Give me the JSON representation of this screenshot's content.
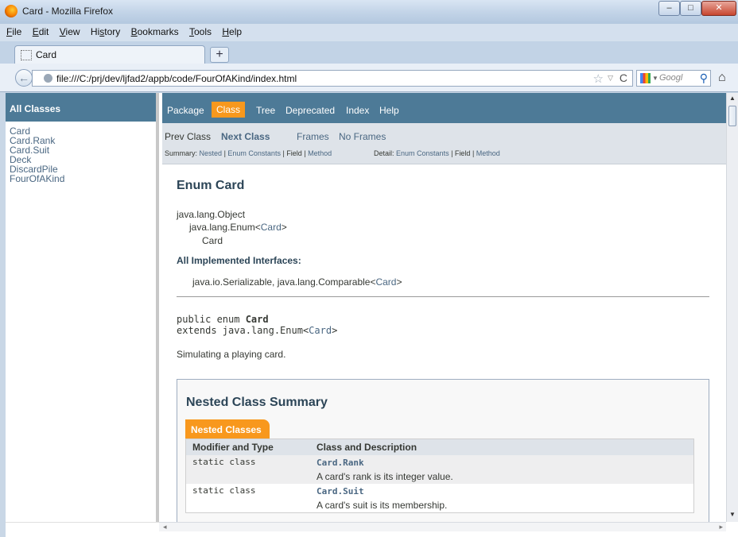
{
  "window": {
    "title": "Card - Mozilla Firefox",
    "min_label": "–",
    "max_label": "□",
    "close_label": "✕"
  },
  "menu": [
    {
      "label_u": "F",
      "label_rest": "ile"
    },
    {
      "label_u": "E",
      "label_rest": "dit"
    },
    {
      "label_u": "V",
      "label_rest": "iew"
    },
    {
      "label_pre": "Hi",
      "label_u": "s",
      "label_rest": "tory"
    },
    {
      "label_u": "B",
      "label_rest": "ookmarks"
    },
    {
      "label_u": "T",
      "label_rest": "ools"
    },
    {
      "label_u": "H",
      "label_rest": "elp"
    }
  ],
  "tabs": {
    "active_label": "Card",
    "new_tab_label": "+"
  },
  "navbar": {
    "url": "file:///C:/prj/dev/ljfad2/appb/code/FourOfAKind/index.html",
    "search_placeholder": "Googl",
    "back_icon": "←",
    "star_icon": "☆",
    "dropdown_icon": "▽",
    "reload_icon": "C",
    "search_icon": "🔍",
    "home_icon": "⌂"
  },
  "left_frame": {
    "heading": "All Classes",
    "classes": [
      "Card",
      "Card.Rank",
      "Card.Suit",
      "Deck",
      "DiscardPile",
      "FourOfAKind"
    ]
  },
  "topnav": {
    "package": "Package",
    "class": "Class",
    "tree": "Tree",
    "deprecated": "Deprecated",
    "index": "Index",
    "help": "Help"
  },
  "subnav": {
    "prev_class": "Prev Class",
    "next_class": "Next Class",
    "frames": "Frames",
    "no_frames": "No Frames",
    "summary_label": "Summary:",
    "summary_nested": "Nested",
    "sep1": " | ",
    "summary_enum_constants": "Enum Constants",
    "summary_field": "Field",
    "summary_method": "Method",
    "detail_label": "Detail:",
    "detail_enum_constants": "Enum Constants",
    "detail_field": "Field",
    "detail_method": "Method"
  },
  "main": {
    "title": "Enum Card",
    "hierarchy_1": "java.lang.Object",
    "hierarchy_2_prefix": "java.lang.Enum<",
    "hierarchy_2_link": "Card",
    "hierarchy_2_suffix": ">",
    "hierarchy_3": "Card",
    "interfaces_heading": "All Implemented Interfaces:",
    "interfaces_prefix": "java.io.Serializable, java.lang.Comparable<",
    "interfaces_link": "Card",
    "interfaces_suffix": ">",
    "decl_line1_prefix": "public enum ",
    "decl_line1_name": "Card",
    "decl_line2_prefix": "extends java.lang.Enum<",
    "decl_line2_link": "Card",
    "decl_line2_suffix": ">",
    "description": "Simulating a playing card."
  },
  "nested_summary": {
    "heading": "Nested Class Summary",
    "caption": "Nested Classes",
    "columns": [
      "Modifier and Type",
      "Class and Description"
    ],
    "rows": [
      {
        "modifier": "static class",
        "name": "Card.Rank",
        "desc": "A card's rank is its integer value."
      },
      {
        "modifier": "static class",
        "name": "Card.Suit",
        "desc": "A card's suit is its membership."
      }
    ]
  },
  "colors": {
    "nav_bg": "#4d7a97",
    "active_tab": "#f8981d",
    "subnav_bg": "#dee3e9",
    "link": "#4a6782"
  }
}
